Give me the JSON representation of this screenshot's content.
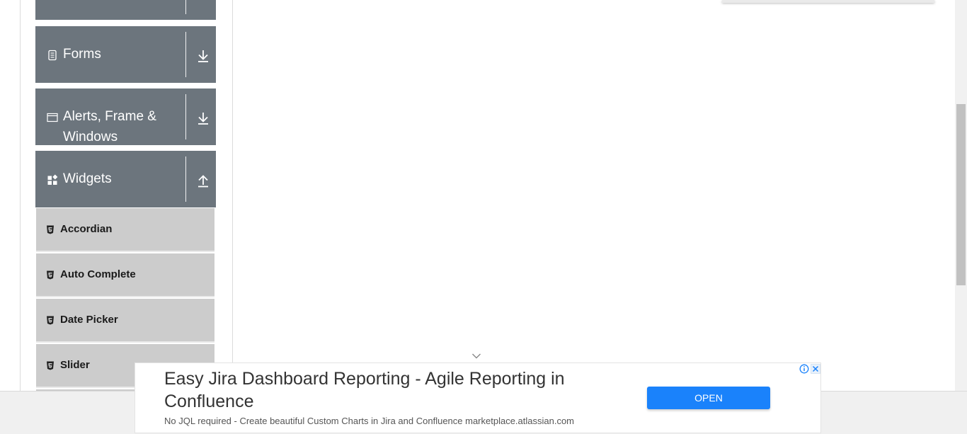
{
  "sidebar": {
    "groups": [
      {
        "label": "",
        "icon": "stack-icon",
        "toggle": "chevron-down-icon"
      },
      {
        "label": "Forms",
        "icon": "document-icon",
        "toggle": "download-arrow-icon"
      },
      {
        "label_line1": "Alerts, Frame &",
        "label_line2": "Windows",
        "icon": "window-icon",
        "toggle": "download-arrow-icon"
      },
      {
        "label": "Widgets",
        "icon": "widgets-icon",
        "toggle": "upload-arrow-icon"
      }
    ],
    "items": [
      {
        "label": "Accordian",
        "icon": "html5-icon"
      },
      {
        "label": "Auto Complete",
        "icon": "html5-icon"
      },
      {
        "label": "Date Picker",
        "icon": "html5-icon"
      },
      {
        "label": "Slider",
        "icon": "html5-icon"
      }
    ]
  },
  "ad": {
    "title": "Easy Jira Dashboard Reporting - Agile Reporting in Confluence",
    "description": "No JQL required - Create beautiful Custom Charts in Jira and Confluence marketplace.atlassian.com",
    "button_label": "OPEN",
    "button_color": "#1a82fb",
    "info_icon": "info-icon",
    "close_icon": "close-icon"
  },
  "colors": {
    "group_bg": "#6c757d",
    "item_bg": "#cccccc"
  }
}
